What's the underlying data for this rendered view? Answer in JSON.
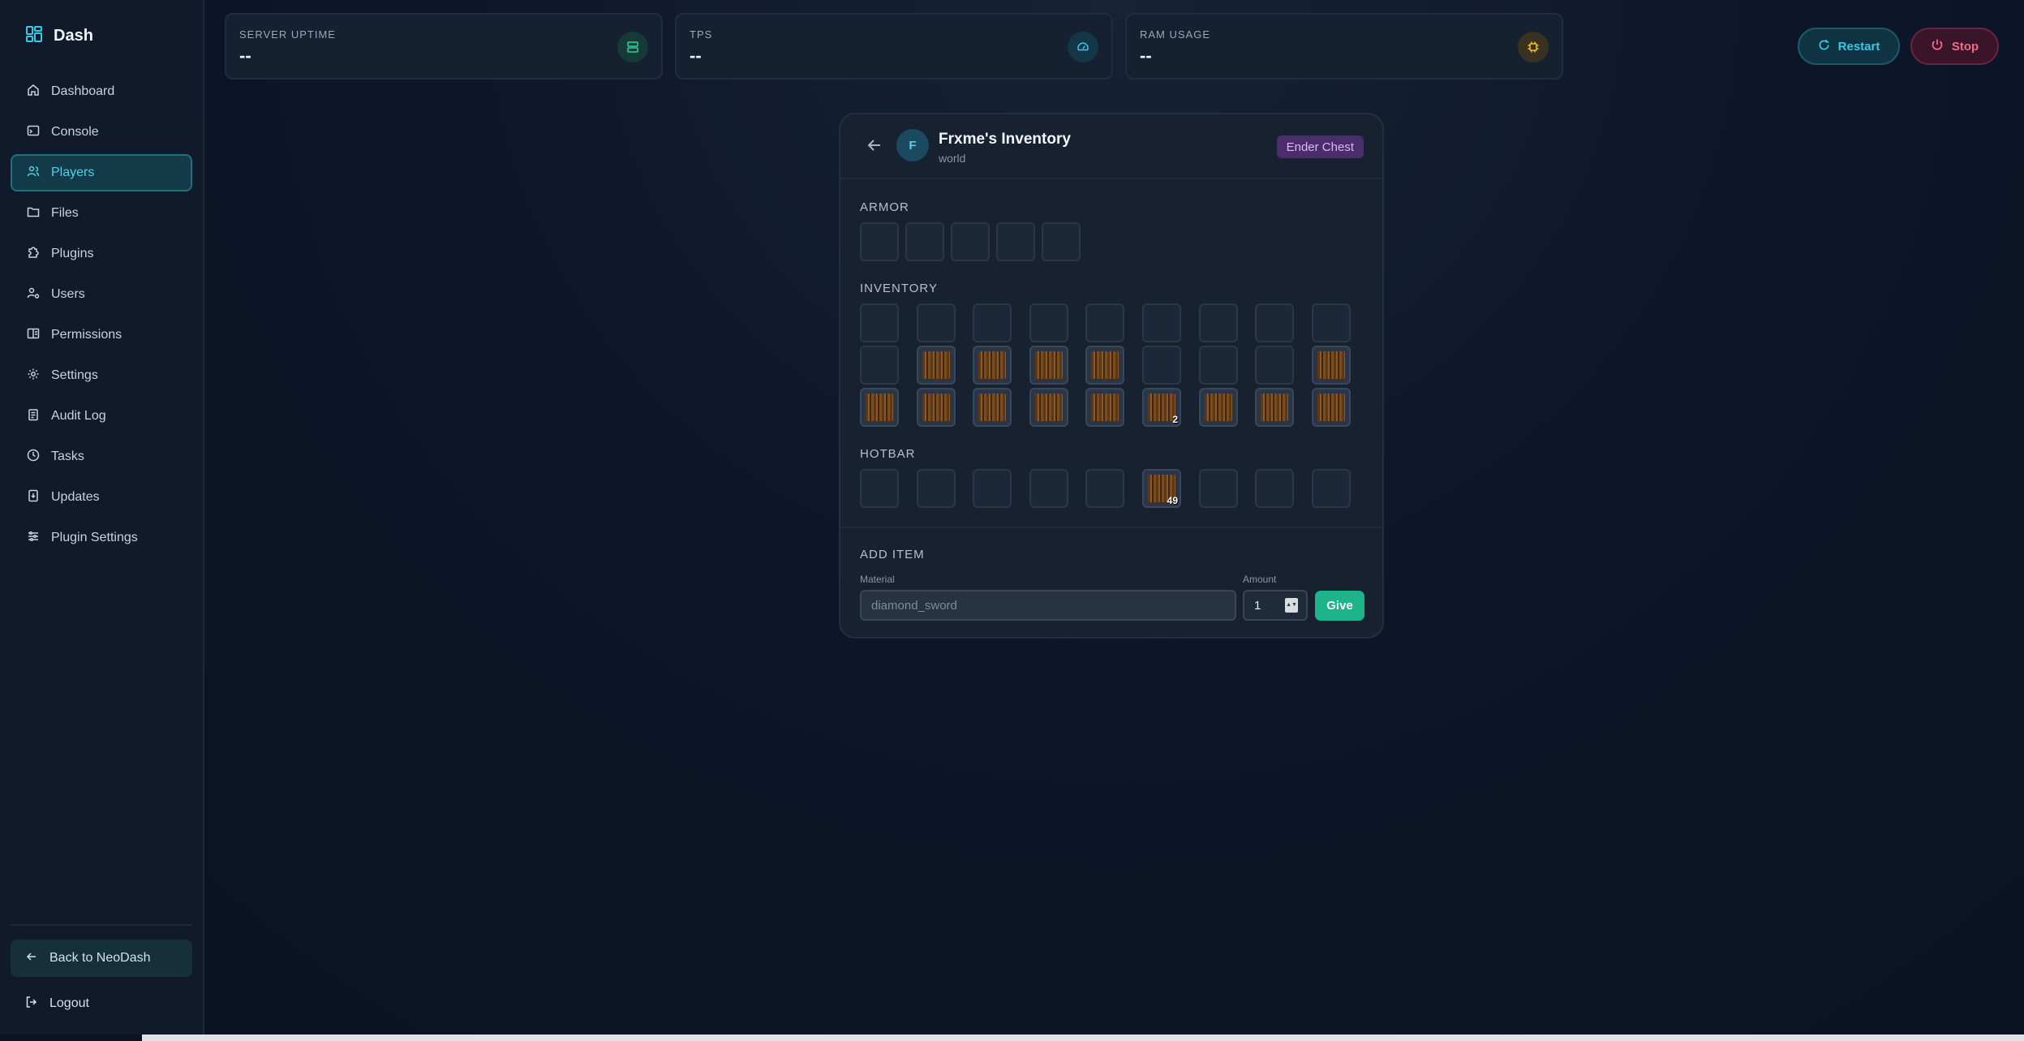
{
  "brand": {
    "name": "Dash",
    "icon": "dashboard-grid-icon"
  },
  "sidebar": {
    "items": [
      {
        "label": "Dashboard",
        "icon": "home-icon"
      },
      {
        "label": "Console",
        "icon": "terminal-icon"
      },
      {
        "label": "Players",
        "icon": "users-icon",
        "active": true
      },
      {
        "label": "Files",
        "icon": "folder-icon"
      },
      {
        "label": "Plugins",
        "icon": "puzzle-icon"
      },
      {
        "label": "Users",
        "icon": "user-cog-icon"
      },
      {
        "label": "Permissions",
        "icon": "book-icon"
      },
      {
        "label": "Settings",
        "icon": "gear-icon"
      },
      {
        "label": "Audit Log",
        "icon": "clipboard-icon"
      },
      {
        "label": "Tasks",
        "icon": "clock-icon"
      },
      {
        "label": "Updates",
        "icon": "download-icon"
      },
      {
        "label": "Plugin Settings",
        "icon": "sliders-icon"
      }
    ],
    "back_label": "Back to NeoDash",
    "logout_label": "Logout"
  },
  "stats": [
    {
      "label": "SERVER UPTIME",
      "value": "--",
      "icon": "server-icon"
    },
    {
      "label": "TPS",
      "value": "--",
      "icon": "gauge-icon"
    },
    {
      "label": "RAM USAGE",
      "value": "--",
      "icon": "chip-icon"
    }
  ],
  "actions": {
    "restart_label": "Restart",
    "stop_label": "Stop"
  },
  "inventory": {
    "avatar_letter": "F",
    "title": "Frxme's Inventory",
    "world": "world",
    "badge": "Ender Chest",
    "armor_label": "ARMOR",
    "inventory_label": "INVENTORY",
    "hotbar_label": "HOTBAR",
    "armor_slots": [
      null,
      null,
      null,
      null,
      null
    ],
    "inventory_rows": [
      [
        null,
        null,
        null,
        null,
        null,
        null,
        null,
        null,
        null
      ],
      [
        null,
        {
          "item": "wood"
        },
        {
          "item": "wood"
        },
        {
          "item": "wood"
        },
        {
          "item": "wood"
        },
        null,
        null,
        null,
        {
          "item": "wood"
        }
      ],
      [
        {
          "item": "wood"
        },
        {
          "item": "wood"
        },
        {
          "item": "wood"
        },
        {
          "item": "wood"
        },
        {
          "item": "wood"
        },
        {
          "item": "wood",
          "count": "2"
        },
        {
          "item": "wood"
        },
        {
          "item": "wood"
        },
        {
          "item": "wood"
        }
      ]
    ],
    "hotbar": [
      null,
      null,
      null,
      null,
      null,
      {
        "item": "wood",
        "count": "49"
      },
      null,
      null,
      null
    ]
  },
  "add_item": {
    "heading": "ADD ITEM",
    "material_label": "Material",
    "material_placeholder": "diamond_sword",
    "amount_label": "Amount",
    "amount_value": "1",
    "give_label": "Give"
  }
}
